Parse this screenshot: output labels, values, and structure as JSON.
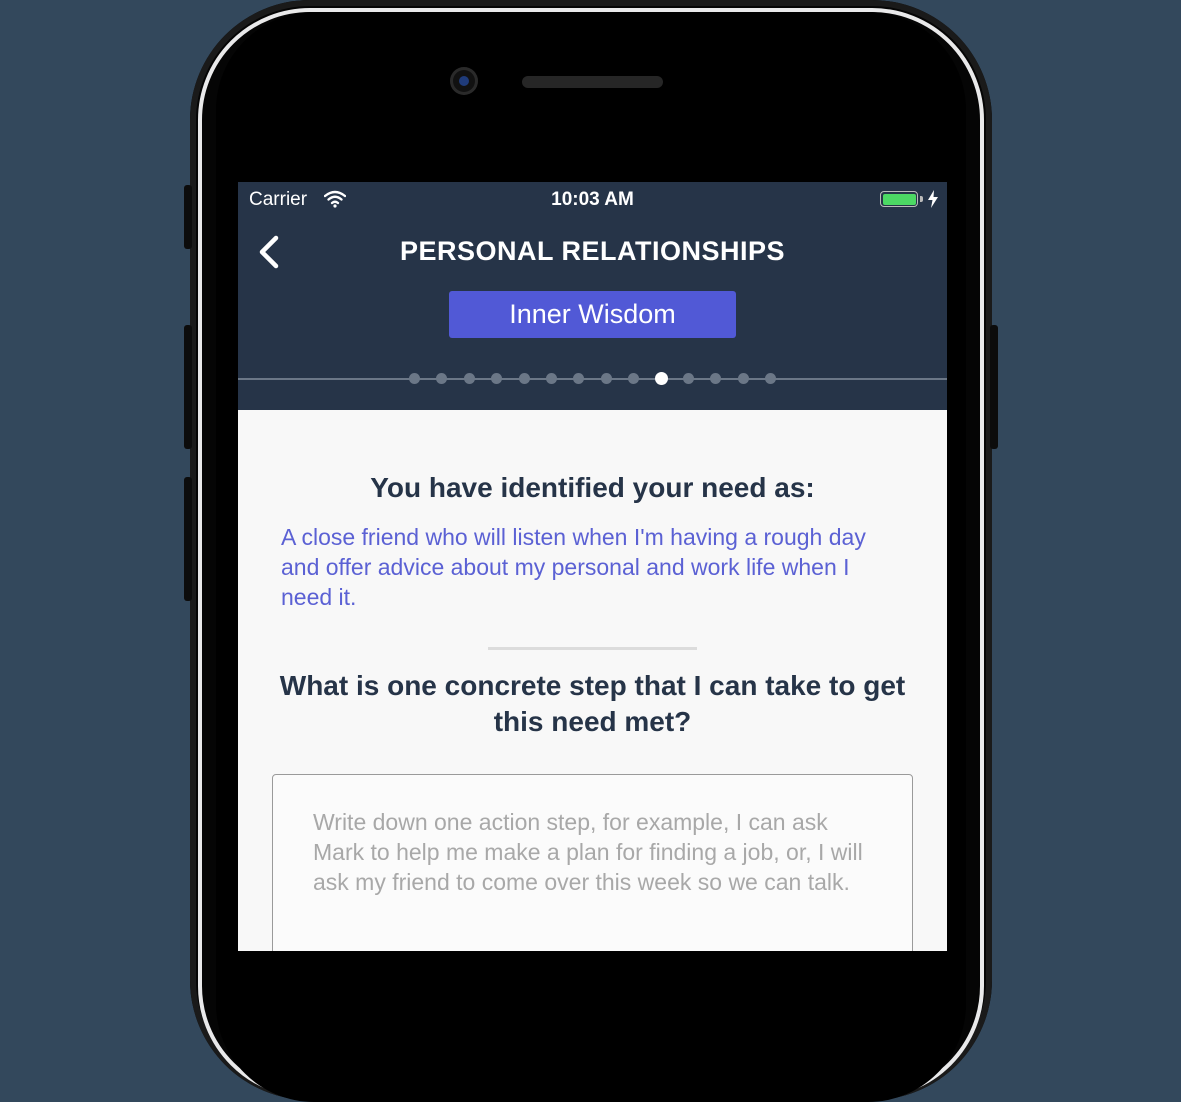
{
  "status_bar": {
    "carrier": "Carrier",
    "time": "10:03 AM"
  },
  "header": {
    "title": "PERSONAL RELATIONSHIPS",
    "section_label": "Inner Wisdom",
    "progress": {
      "total_steps": 14,
      "current_step": 10
    }
  },
  "content": {
    "need_heading": "You have identified your need as:",
    "need_text": "A close friend who will listen when I'm having a rough day and offer advice about my personal and work life when I need it.",
    "question": "What is one concrete step that I can take to get this need met?",
    "answer_placeholder": "Write down one action step, for example, I can ask Mark to help me make a plan for finding a job, or, I will ask my friend to come over this week so we can talk.",
    "answer_value": ""
  },
  "colors": {
    "background": "#33485c",
    "header": "#263448",
    "accent": "#5159d6",
    "need_text": "#5b61d4",
    "battery": "#4cd964"
  },
  "icons": {
    "back": "chevron-left-icon",
    "wifi": "wifi-icon",
    "battery": "battery-icon",
    "charging": "lightning-bolt-icon"
  }
}
